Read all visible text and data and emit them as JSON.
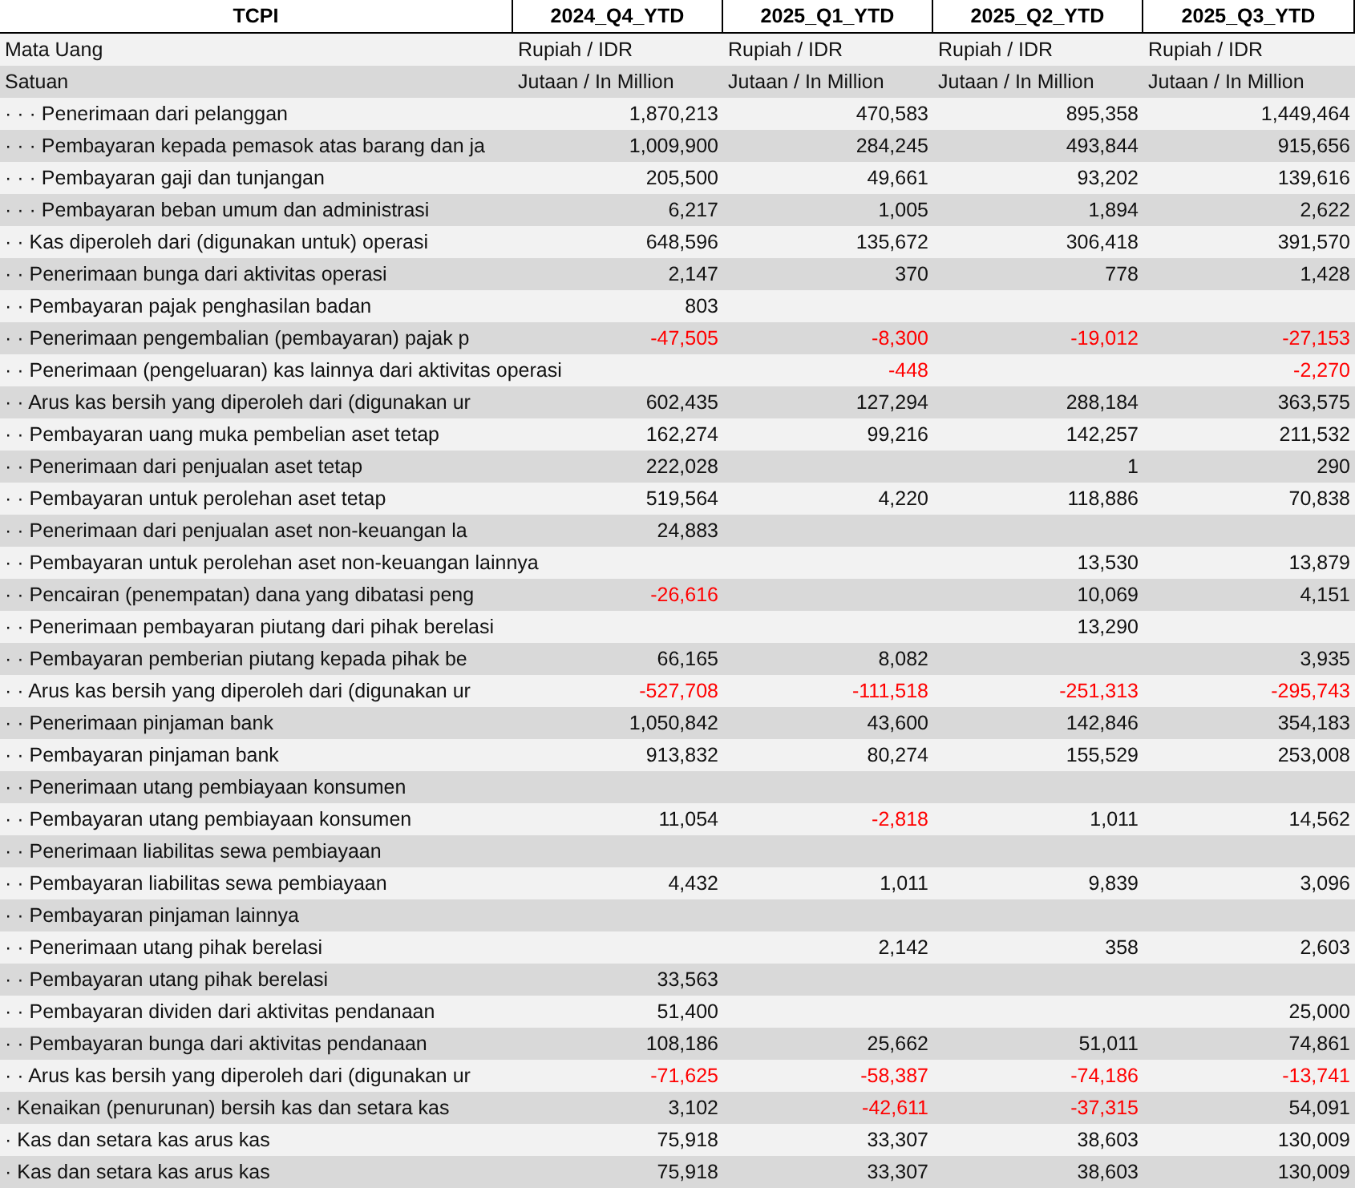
{
  "table": {
    "columns": [
      "TCPI",
      "2024_Q4_YTD",
      "2025_Q1_YTD",
      "2025_Q2_YTD",
      "2025_Q3_YTD"
    ],
    "rows": [
      {
        "kind": "unit",
        "label": "Mata Uang",
        "cells": {
          "q4_2024": {
            "text": "Rupiah / IDR",
            "negative": false
          },
          "q1_2025": {
            "text": "Rupiah / IDR",
            "negative": false
          },
          "q2_2025": {
            "text": "Rupiah / IDR",
            "negative": false
          },
          "q3_2025": {
            "text": "Rupiah / IDR",
            "negative": false
          }
        }
      },
      {
        "kind": "unit",
        "label": "Satuan",
        "cells": {
          "q4_2024": {
            "text": "Jutaan / In Million",
            "negative": false
          },
          "q1_2025": {
            "text": "Jutaan / In Million",
            "negative": false
          },
          "q2_2025": {
            "text": "Jutaan / In Million",
            "negative": false
          },
          "q3_2025": {
            "text": "Jutaan / In Million",
            "negative": false
          }
        }
      },
      {
        "kind": "item",
        "label": "· · · Penerimaan dari pelanggan",
        "cells": {
          "q4_2024": {
            "text": "1,870,213",
            "negative": false
          },
          "q1_2025": {
            "text": "470,583",
            "negative": false
          },
          "q2_2025": {
            "text": "895,358",
            "negative": false
          },
          "q3_2025": {
            "text": "1,449,464",
            "negative": false
          }
        }
      },
      {
        "kind": "item",
        "label": "· · · Pembayaran kepada pemasok atas barang dan ja",
        "cells": {
          "q4_2024": {
            "text": "1,009,900",
            "negative": false
          },
          "q1_2025": {
            "text": "284,245",
            "negative": false
          },
          "q2_2025": {
            "text": "493,844",
            "negative": false
          },
          "q3_2025": {
            "text": "915,656",
            "negative": false
          }
        }
      },
      {
        "kind": "item",
        "label": "· · · Pembayaran gaji dan tunjangan",
        "cells": {
          "q4_2024": {
            "text": "205,500",
            "negative": false
          },
          "q1_2025": {
            "text": "49,661",
            "negative": false
          },
          "q2_2025": {
            "text": "93,202",
            "negative": false
          },
          "q3_2025": {
            "text": "139,616",
            "negative": false
          }
        }
      },
      {
        "kind": "item",
        "label": "· · · Pembayaran beban umum dan administrasi",
        "cells": {
          "q4_2024": {
            "text": "6,217",
            "negative": false
          },
          "q1_2025": {
            "text": "1,005",
            "negative": false
          },
          "q2_2025": {
            "text": "1,894",
            "negative": false
          },
          "q3_2025": {
            "text": "2,622",
            "negative": false
          }
        }
      },
      {
        "kind": "item",
        "label": "· · Kas diperoleh dari (digunakan untuk) operasi",
        "cells": {
          "q4_2024": {
            "text": "648,596",
            "negative": false
          },
          "q1_2025": {
            "text": "135,672",
            "negative": false
          },
          "q2_2025": {
            "text": "306,418",
            "negative": false
          },
          "q3_2025": {
            "text": "391,570",
            "negative": false
          }
        }
      },
      {
        "kind": "item",
        "label": "· · Penerimaan bunga dari aktivitas operasi",
        "cells": {
          "q4_2024": {
            "text": "2,147",
            "negative": false
          },
          "q1_2025": {
            "text": "370",
            "negative": false
          },
          "q2_2025": {
            "text": "778",
            "negative": false
          },
          "q3_2025": {
            "text": "1,428",
            "negative": false
          }
        }
      },
      {
        "kind": "item",
        "label": "· · Pembayaran pajak penghasilan badan",
        "cells": {
          "q4_2024": {
            "text": "803",
            "negative": false
          }
        }
      },
      {
        "kind": "item",
        "label": "· · Penerimaan pengembalian (pembayaran) pajak p",
        "cells": {
          "q4_2024": {
            "text": "-47,505",
            "negative": true
          },
          "q1_2025": {
            "text": "-8,300",
            "negative": true
          },
          "q2_2025": {
            "text": "-19,012",
            "negative": true
          },
          "q3_2025": {
            "text": "-27,153",
            "negative": true
          }
        }
      },
      {
        "kind": "item",
        "label": "· · Penerimaan (pengeluaran) kas lainnya dari aktivitas operasi",
        "cells": {
          "q1_2025": {
            "text": "-448",
            "negative": true
          },
          "q3_2025": {
            "text": "-2,270",
            "negative": true
          }
        }
      },
      {
        "kind": "item",
        "label": "· · Arus kas bersih yang diperoleh dari (digunakan ur",
        "cells": {
          "q4_2024": {
            "text": "602,435",
            "negative": false
          },
          "q1_2025": {
            "text": "127,294",
            "negative": false
          },
          "q2_2025": {
            "text": "288,184",
            "negative": false
          },
          "q3_2025": {
            "text": "363,575",
            "negative": false
          }
        }
      },
      {
        "kind": "item",
        "label": "· · Pembayaran uang muka pembelian aset tetap",
        "cells": {
          "q4_2024": {
            "text": "162,274",
            "negative": false
          },
          "q1_2025": {
            "text": "99,216",
            "negative": false
          },
          "q2_2025": {
            "text": "142,257",
            "negative": false
          },
          "q3_2025": {
            "text": "211,532",
            "negative": false
          }
        }
      },
      {
        "kind": "item",
        "label": "· · Penerimaan dari penjualan aset tetap",
        "cells": {
          "q4_2024": {
            "text": "222,028",
            "negative": false
          },
          "q2_2025": {
            "text": "1",
            "negative": false
          },
          "q3_2025": {
            "text": "290",
            "negative": false
          }
        }
      },
      {
        "kind": "item",
        "label": "· · Pembayaran untuk perolehan aset tetap",
        "cells": {
          "q4_2024": {
            "text": "519,564",
            "negative": false
          },
          "q1_2025": {
            "text": "4,220",
            "negative": false
          },
          "q2_2025": {
            "text": "118,886",
            "negative": false
          },
          "q3_2025": {
            "text": "70,838",
            "negative": false
          }
        }
      },
      {
        "kind": "item",
        "label": "· · Penerimaan dari penjualan aset non-keuangan la",
        "cells": {
          "q4_2024": {
            "text": "24,883",
            "negative": false
          }
        }
      },
      {
        "kind": "item",
        "label": "· · Pembayaran untuk perolehan aset non-keuangan lainnya",
        "cells": {
          "q2_2025": {
            "text": "13,530",
            "negative": false
          },
          "q3_2025": {
            "text": "13,879",
            "negative": false
          }
        }
      },
      {
        "kind": "item",
        "label": "· · Pencairan (penempatan) dana yang dibatasi peng",
        "cells": {
          "q4_2024": {
            "text": "-26,616",
            "negative": true
          },
          "q2_2025": {
            "text": "10,069",
            "negative": false
          },
          "q3_2025": {
            "text": "4,151",
            "negative": false
          }
        }
      },
      {
        "kind": "item",
        "label": "· · Penerimaan pembayaran piutang dari pihak berelasi",
        "cells": {
          "q2_2025": {
            "text": "13,290",
            "negative": false
          }
        }
      },
      {
        "kind": "item",
        "label": "· · Pembayaran pemberian piutang kepada pihak be",
        "cells": {
          "q4_2024": {
            "text": "66,165",
            "negative": false
          },
          "q1_2025": {
            "text": "8,082",
            "negative": false
          },
          "q3_2025": {
            "text": "3,935",
            "negative": false
          }
        }
      },
      {
        "kind": "item",
        "label": "· · Arus kas bersih yang diperoleh dari (digunakan ur",
        "cells": {
          "q4_2024": {
            "text": "-527,708",
            "negative": true
          },
          "q1_2025": {
            "text": "-111,518",
            "negative": true
          },
          "q2_2025": {
            "text": "-251,313",
            "negative": true
          },
          "q3_2025": {
            "text": "-295,743",
            "negative": true
          }
        }
      },
      {
        "kind": "item",
        "label": "· · Penerimaan pinjaman bank",
        "cells": {
          "q4_2024": {
            "text": "1,050,842",
            "negative": false
          },
          "q1_2025": {
            "text": "43,600",
            "negative": false
          },
          "q2_2025": {
            "text": "142,846",
            "negative": false
          },
          "q3_2025": {
            "text": "354,183",
            "negative": false
          }
        }
      },
      {
        "kind": "item",
        "label": "· · Pembayaran pinjaman bank",
        "cells": {
          "q4_2024": {
            "text": "913,832",
            "negative": false
          },
          "q1_2025": {
            "text": "80,274",
            "negative": false
          },
          "q2_2025": {
            "text": "155,529",
            "negative": false
          },
          "q3_2025": {
            "text": "253,008",
            "negative": false
          }
        }
      },
      {
        "kind": "item",
        "label": "· · Penerimaan utang pembiayaan konsumen"
      },
      {
        "kind": "item",
        "label": "· · Pembayaran utang pembiayaan konsumen",
        "cells": {
          "q4_2024": {
            "text": "11,054",
            "negative": false
          },
          "q1_2025": {
            "text": "-2,818",
            "negative": true
          },
          "q2_2025": {
            "text": "1,011",
            "negative": false
          },
          "q3_2025": {
            "text": "14,562",
            "negative": false
          }
        }
      },
      {
        "kind": "item",
        "label": "· · Penerimaan liabilitas sewa pembiayaan"
      },
      {
        "kind": "item",
        "label": "· · Pembayaran liabilitas sewa pembiayaan",
        "cells": {
          "q4_2024": {
            "text": "4,432",
            "negative": false
          },
          "q1_2025": {
            "text": "1,011",
            "negative": false
          },
          "q2_2025": {
            "text": "9,839",
            "negative": false
          },
          "q3_2025": {
            "text": "3,096",
            "negative": false
          }
        }
      },
      {
        "kind": "item",
        "label": "· · Pembayaran pinjaman lainnya"
      },
      {
        "kind": "item",
        "label": "· · Penerimaan utang pihak berelasi",
        "cells": {
          "q1_2025": {
            "text": "2,142",
            "negative": false
          },
          "q2_2025": {
            "text": "358",
            "negative": false
          },
          "q3_2025": {
            "text": "2,603",
            "negative": false
          }
        }
      },
      {
        "kind": "item",
        "label": "· · Pembayaran utang pihak berelasi",
        "cells": {
          "q4_2024": {
            "text": "33,563",
            "negative": false
          }
        }
      },
      {
        "kind": "item",
        "label": "· · Pembayaran dividen dari aktivitas pendanaan",
        "cells": {
          "q4_2024": {
            "text": "51,400",
            "negative": false
          },
          "q3_2025": {
            "text": "25,000",
            "negative": false
          }
        }
      },
      {
        "kind": "item",
        "label": "· · Pembayaran bunga dari aktivitas pendanaan",
        "cells": {
          "q4_2024": {
            "text": "108,186",
            "negative": false
          },
          "q1_2025": {
            "text": "25,662",
            "negative": false
          },
          "q2_2025": {
            "text": "51,011",
            "negative": false
          },
          "q3_2025": {
            "text": "74,861",
            "negative": false
          }
        }
      },
      {
        "kind": "item",
        "label": "· · Arus kas bersih yang diperoleh dari (digunakan ur",
        "cells": {
          "q4_2024": {
            "text": "-71,625",
            "negative": true
          },
          "q1_2025": {
            "text": "-58,387",
            "negative": true
          },
          "q2_2025": {
            "text": "-74,186",
            "negative": true
          },
          "q3_2025": {
            "text": "-13,741",
            "negative": true
          }
        }
      },
      {
        "kind": "item",
        "label": "· Kenaikan (penurunan) bersih kas dan setara kas",
        "cells": {
          "q4_2024": {
            "text": "3,102",
            "negative": false
          },
          "q1_2025": {
            "text": "-42,611",
            "negative": true
          },
          "q2_2025": {
            "text": "-37,315",
            "negative": true
          },
          "q3_2025": {
            "text": "54,091",
            "negative": false
          }
        }
      },
      {
        "kind": "item",
        "label": "· Kas dan setara kas arus kas",
        "cells": {
          "q4_2024": {
            "text": "75,918",
            "negative": false
          },
          "q1_2025": {
            "text": "33,307",
            "negative": false
          },
          "q2_2025": {
            "text": "38,603",
            "negative": false
          },
          "q3_2025": {
            "text": "130,009",
            "negative": false
          }
        }
      },
      {
        "kind": "item",
        "label": "· Kas dan setara kas arus kas",
        "cells": {
          "q4_2024": {
            "text": "75,918",
            "negative": false
          },
          "q1_2025": {
            "text": "33,307",
            "negative": false
          },
          "q2_2025": {
            "text": "38,603",
            "negative": false
          },
          "q3_2025": {
            "text": "130,009",
            "negative": false
          }
        }
      }
    ]
  }
}
